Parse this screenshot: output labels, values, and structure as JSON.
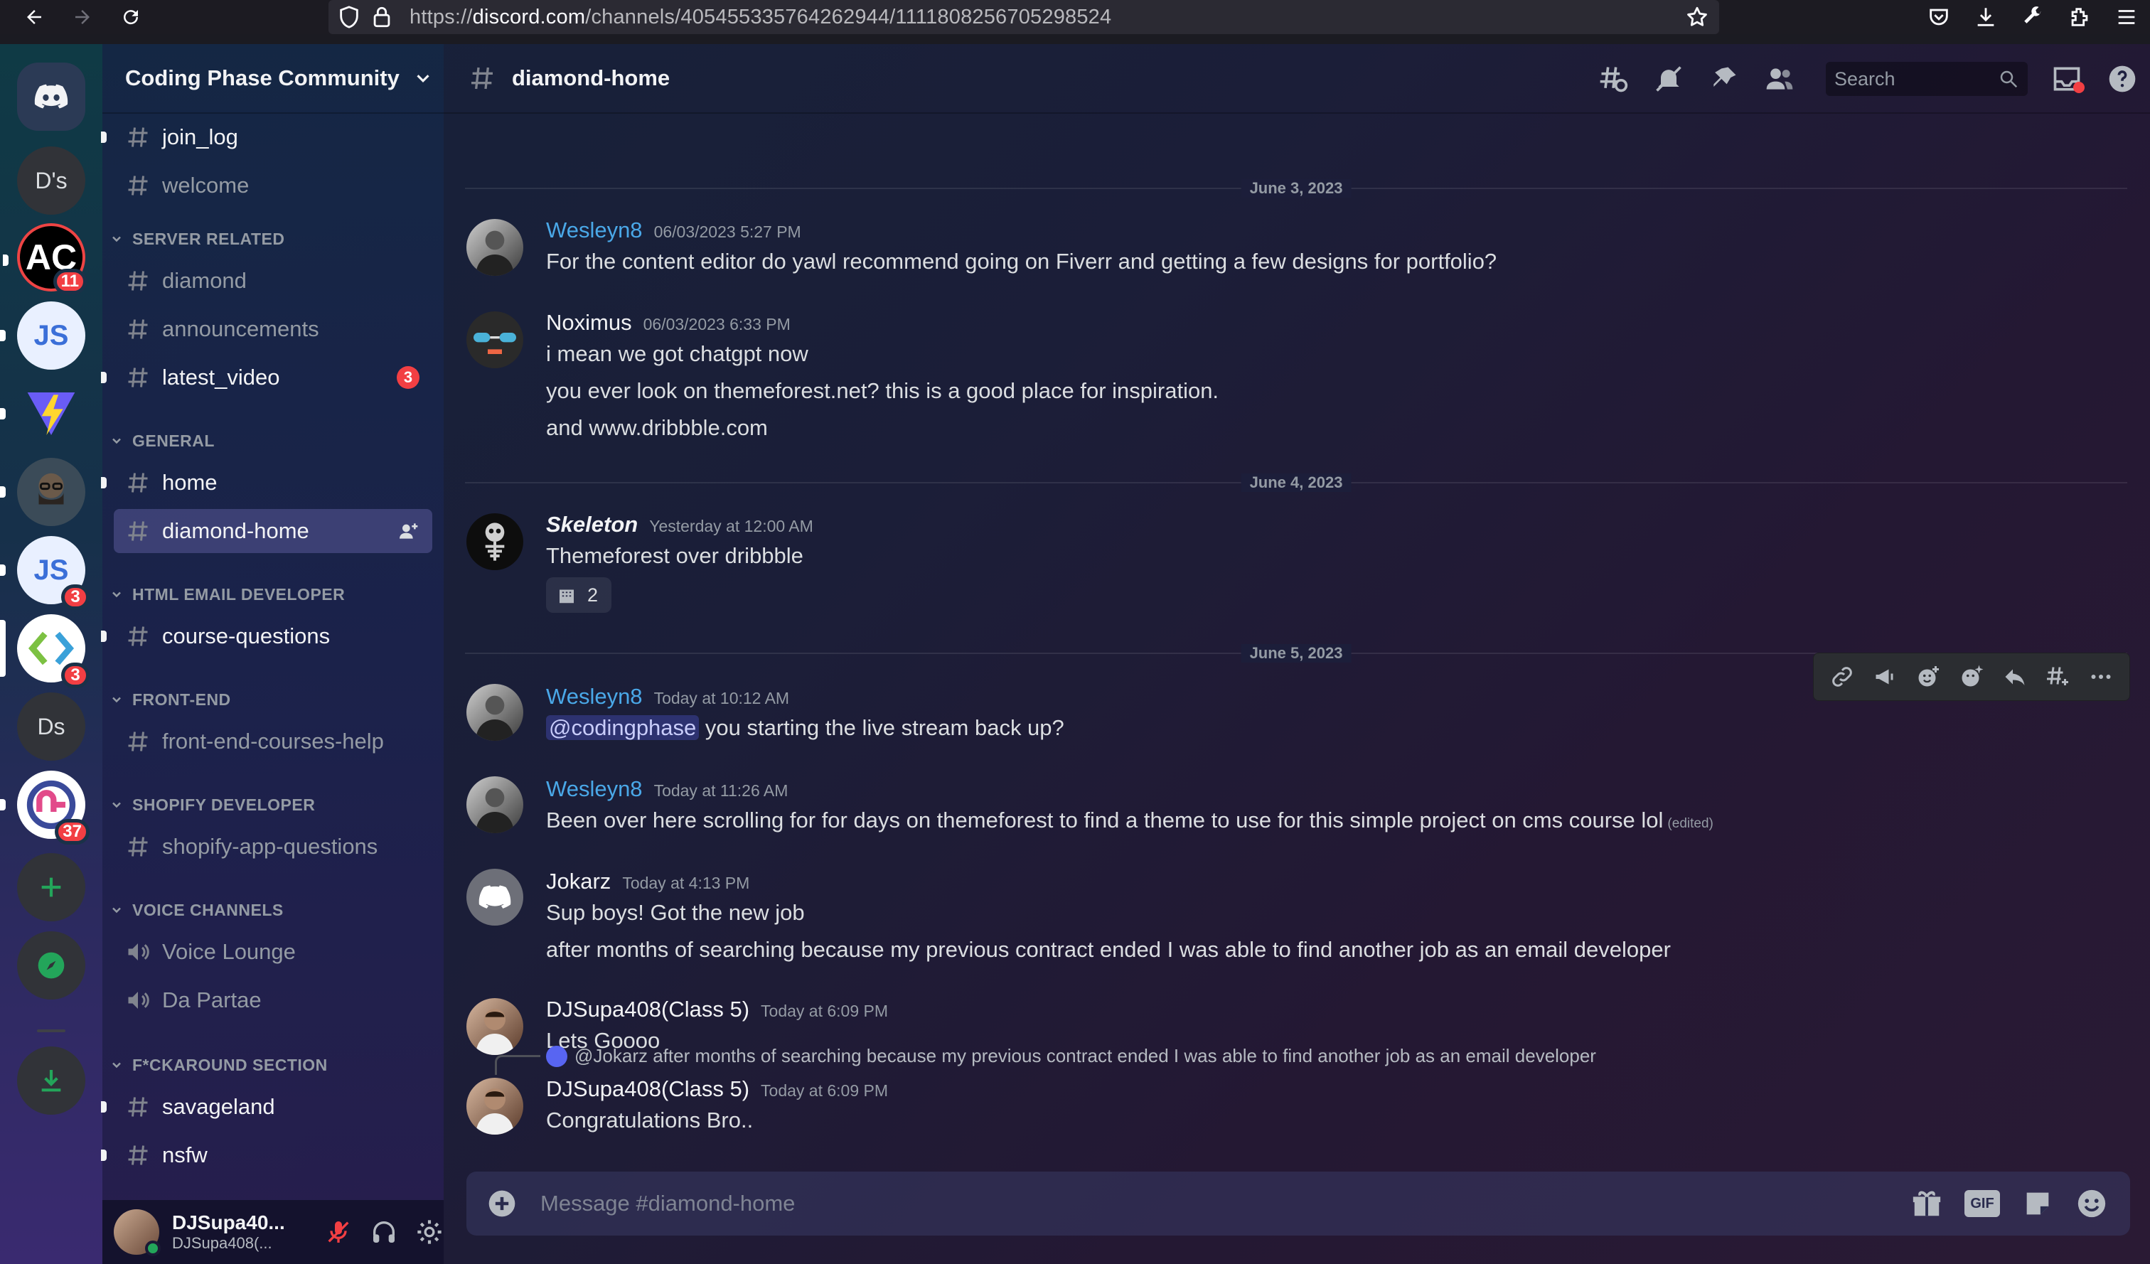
{
  "browser": {
    "url_prefix": "https://",
    "url_domain": "discord.com",
    "url_path": "/channels/405455335764262944/1111808256705298524"
  },
  "rail": {
    "servers": [
      {
        "label": "D's",
        "badge": ""
      },
      {
        "label": "AC",
        "badge": "11"
      },
      {
        "label": "JS",
        "badge": ""
      },
      {
        "label": "",
        "badge": ""
      },
      {
        "label": "",
        "badge": ""
      },
      {
        "label": "JS",
        "badge": "3"
      },
      {
        "label": "",
        "badge": "3"
      },
      {
        "label": "Ds",
        "badge": ""
      },
      {
        "label": "",
        "badge": "37"
      }
    ]
  },
  "sidebar": {
    "server_name": "Coding Phase Community",
    "channels": {
      "join_log": "join_log",
      "welcome": "welcome",
      "diamond": "diamond",
      "announcements": "announcements",
      "latest_video": "latest_video",
      "latest_video_badge": "3",
      "home": "home",
      "diamond_home": "diamond-home",
      "course_questions": "course-questions",
      "front_end_help": "front-end-courses-help",
      "shopify_app": "shopify-app-questions",
      "voice_lounge": "Voice Lounge",
      "da_partae": "Da Partae",
      "savageland": "savageland",
      "nsfw": "nsfw"
    },
    "categories": {
      "server_related": "SERVER RELATED",
      "general": "GENERAL",
      "html_email": "HTML EMAIL DEVELOPER",
      "front_end": "FRONT-END",
      "shopify": "SHOPIFY DEVELOPER",
      "voice": "VOICE CHANNELS",
      "fckaround": "F*CKAROUND SECTION"
    }
  },
  "user_panel": {
    "name": "DJSupa40...",
    "tag": "DJSupa408(..."
  },
  "topbar": {
    "channel": "diamond-home",
    "search_placeholder": "Search"
  },
  "dividers": {
    "d1": "June 3, 2023",
    "d2": "June 4, 2023",
    "d3": "June 5, 2023"
  },
  "messages": {
    "m1": {
      "author": "Wesleyn8",
      "time": "06/03/2023 5:27 PM",
      "lines": [
        "For the content editor do yawl recommend going on Fiverr and getting a few designs for portfolio?"
      ]
    },
    "m2": {
      "author": "Noximus",
      "time": "06/03/2023 6:33 PM",
      "lines": [
        "i mean we got chatgpt now",
        "you ever look on themeforest.net?  this is a good place for inspiration.",
        "and www.dribbble.com"
      ]
    },
    "m3": {
      "author": "Skeleton",
      "time": "Yesterday at 12:00 AM",
      "lines": [
        "Themeforest over dribbble"
      ],
      "reaction_count": "2"
    },
    "m4": {
      "author": "Wesleyn8",
      "time": "Today at 10:12 AM",
      "mention": "@codingphase",
      "text": " you starting the live stream back up?"
    },
    "m5": {
      "author": "Wesleyn8",
      "time": "Today at 11:26 AM",
      "text": "Been over here scrolling for for days on themeforest to find a theme to use for this simple project on cms course lol",
      "edited": "(edited)"
    },
    "m6": {
      "author": "Jokarz",
      "time": "Today at 4:13 PM",
      "lines": [
        "Sup boys! Got the new job",
        "after months of searching because my previous contract ended I was able to find another job as an email developer"
      ]
    },
    "m7": {
      "author": "DJSupa408(Class 5)",
      "time": "Today at 6:09 PM",
      "lines": [
        "Lets Goooo"
      ]
    },
    "m8": {
      "reply_ref": "@Jokarz after months of searching because my previous contract ended I was able to find another job as an email developer",
      "author": "DJSupa408(Class 5)",
      "time": "Today at 6:09 PM",
      "lines": [
        "Congratulations Bro.."
      ]
    }
  },
  "composer": {
    "placeholder": "Message #diamond-home",
    "gif_label": "GIF"
  },
  "colors": {
    "accent_blue": "#4aa8e8",
    "mention_red": "#f23f43",
    "online_green": "#23a55a"
  }
}
